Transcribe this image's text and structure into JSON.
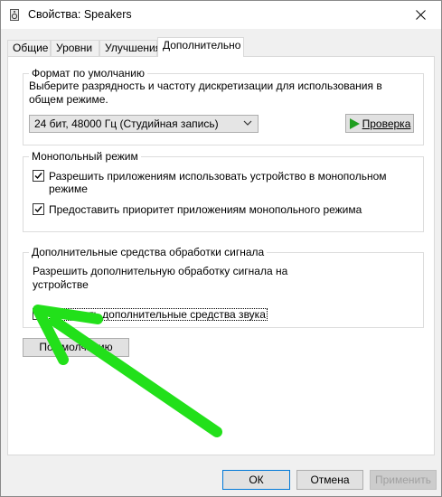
{
  "window": {
    "title": "Свойства: Speakers"
  },
  "tabs": [
    {
      "label": "Общие",
      "active": false
    },
    {
      "label": "Уровни",
      "active": false
    },
    {
      "label": "Улучшения",
      "active": false
    },
    {
      "label": "Дополнительно",
      "active": true
    }
  ],
  "default_format": {
    "legend": "Формат по умолчанию",
    "description": "Выберите разрядность и частоту дискретизации для использования в общем режиме.",
    "selected": "24 бит, 48000 Гц (Студийная запись)",
    "test_label": "Проверка"
  },
  "exclusive_mode": {
    "legend": "Монопольный режим",
    "allow_label": "Разрешить приложениям использовать устройство в монопольном режиме",
    "allow_checked": true,
    "priority_label": "Предоставить приоритет приложениям монопольного режима",
    "priority_checked": true
  },
  "signal_enhancements": {
    "legend": "Дополнительные средства обработки сигнала",
    "description": "Разрешить дополнительную обработку сигнала на устройстве",
    "enable_label": "Включить дополнительные средства звука",
    "enable_checked": false
  },
  "restore_defaults_label": "По умолчанию",
  "footer": {
    "ok_label": "ОК",
    "cancel_label": "Отмена",
    "apply_label": "Применить"
  },
  "colors": {
    "arrow": "#22e01a",
    "play_icon": "#1f9e1f",
    "focus_border": "#0078d7"
  }
}
